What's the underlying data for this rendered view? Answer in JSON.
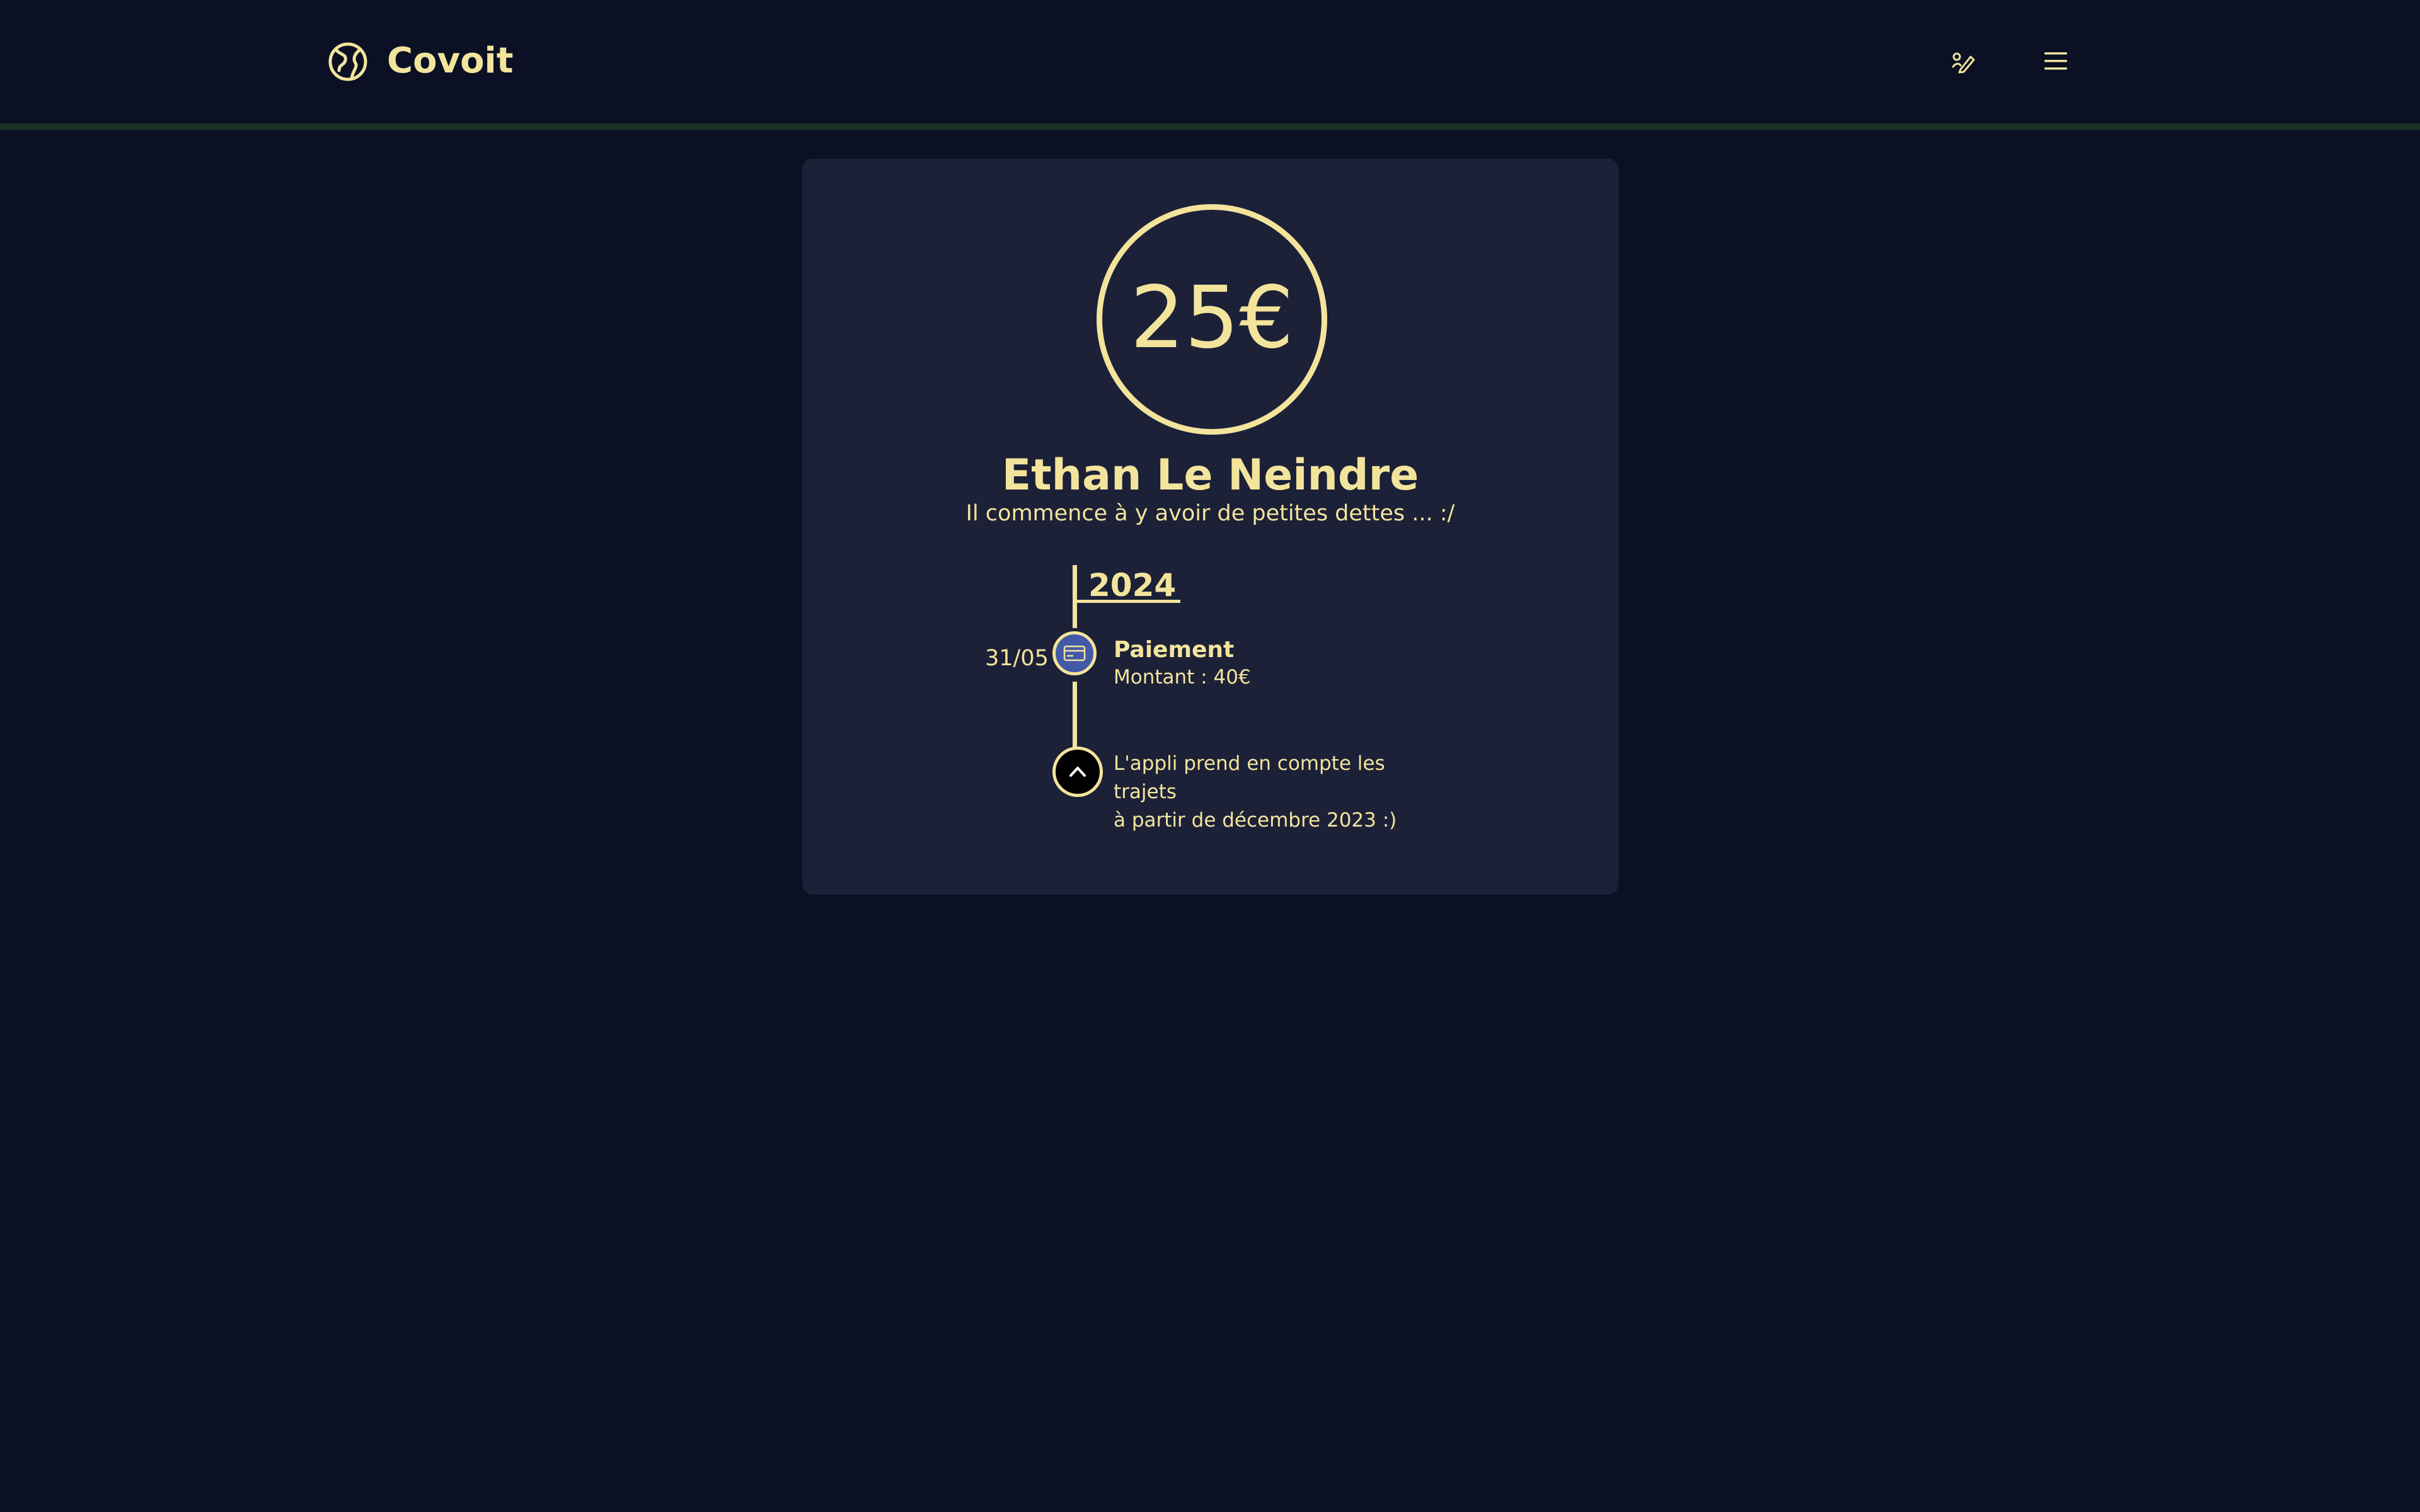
{
  "app": {
    "brand": "Covoit",
    "icons": {
      "logo": "globe-logo-icon",
      "edit": "signature-icon",
      "menu": "hamburger-menu-icon"
    }
  },
  "profile": {
    "amount": "25€",
    "name": "Ethan Le Neindre",
    "subtitle": "Il commence à y avoir de petites dettes ... :/"
  },
  "timeline": {
    "year": "2024",
    "events": [
      {
        "date": "31/05",
        "title": "Paiement",
        "detail": "Montant : 40€",
        "icon": "credit-card-icon"
      }
    ],
    "end_note_line1": "L'appli prend en compte les trajets",
    "end_note_line2": "à partir de décembre 2023 :)",
    "end_icon": "chevron-up-icon"
  },
  "colors": {
    "background": "#0b1024",
    "card": "#1c2138",
    "accent": "#f3e49c",
    "event_dot": "#4259a8",
    "header_border": "#1a3326"
  }
}
